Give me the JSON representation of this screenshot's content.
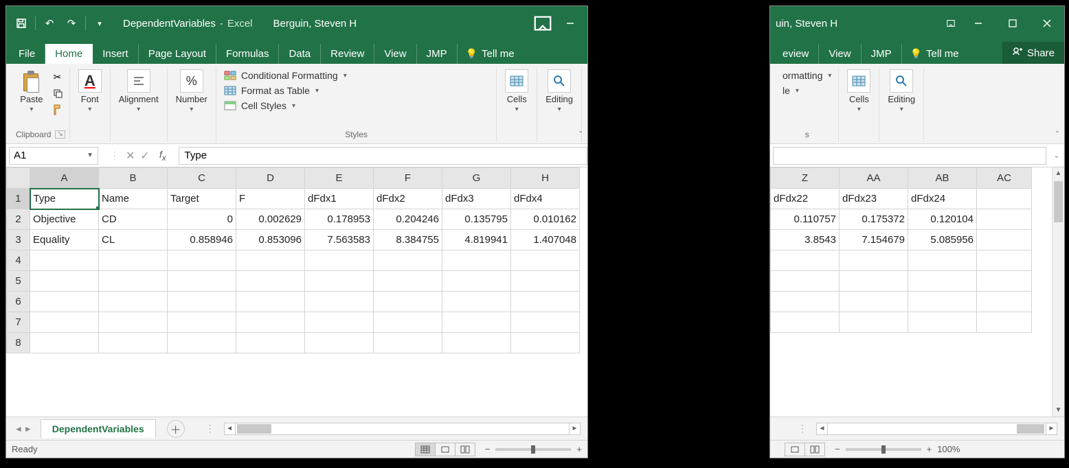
{
  "left": {
    "title": {
      "filename": "DependentVariables",
      "sep": "-",
      "app": "Excel",
      "user": "Berguin, Steven H"
    },
    "tabs": [
      "File",
      "Home",
      "Insert",
      "Page Layout",
      "Formulas",
      "Data",
      "Review",
      "View",
      "JMP"
    ],
    "active_tab": "Home",
    "tell_me": "Tell me",
    "ribbon": {
      "clipboard": {
        "paste": "Paste",
        "label": "Clipboard"
      },
      "font": {
        "btn": "Font",
        "label": ""
      },
      "alignment": {
        "btn": "Alignment"
      },
      "number": {
        "btn": "Number"
      },
      "styles": {
        "cond": "Conditional Formatting",
        "table": "Format as Table",
        "cell": "Cell Styles",
        "label": "Styles"
      },
      "cells": {
        "btn": "Cells"
      },
      "editing": {
        "btn": "Editing"
      }
    },
    "namebox": "A1",
    "formula": "Type",
    "columns": [
      "A",
      "B",
      "C",
      "D",
      "E",
      "F",
      "G",
      "H"
    ],
    "widths": [
      100,
      100,
      100,
      100,
      100,
      100,
      100,
      100
    ],
    "rows": [
      {
        "n": 1,
        "cells": [
          {
            "v": "Type",
            "t": "txt",
            "active": true
          },
          {
            "v": "Name",
            "t": "txt"
          },
          {
            "v": "Target",
            "t": "txt"
          },
          {
            "v": "F",
            "t": "txt"
          },
          {
            "v": "dFdx1",
            "t": "txt"
          },
          {
            "v": "dFdx2",
            "t": "txt"
          },
          {
            "v": "dFdx3",
            "t": "txt"
          },
          {
            "v": "dFdx4",
            "t": "txt"
          }
        ]
      },
      {
        "n": 2,
        "cells": [
          {
            "v": "Objective",
            "t": "txt"
          },
          {
            "v": "CD",
            "t": "txt"
          },
          {
            "v": "0",
            "t": "num"
          },
          {
            "v": "0.002629",
            "t": "num"
          },
          {
            "v": "0.178953",
            "t": "num"
          },
          {
            "v": "0.204246",
            "t": "num"
          },
          {
            "v": "0.135795",
            "t": "num"
          },
          {
            "v": "0.010162",
            "t": "num"
          }
        ]
      },
      {
        "n": 3,
        "cells": [
          {
            "v": "Equality",
            "t": "txt"
          },
          {
            "v": "CL",
            "t": "txt"
          },
          {
            "v": "0.858946",
            "t": "num"
          },
          {
            "v": "0.853096",
            "t": "num"
          },
          {
            "v": "7.563583",
            "t": "num"
          },
          {
            "v": "8.384755",
            "t": "num"
          },
          {
            "v": "4.819941",
            "t": "num"
          },
          {
            "v": "1.407048",
            "t": "num"
          }
        ]
      },
      {
        "n": 4,
        "cells": [
          {
            "v": ""
          },
          {
            "v": ""
          },
          {
            "v": ""
          },
          {
            "v": ""
          },
          {
            "v": ""
          },
          {
            "v": ""
          },
          {
            "v": ""
          },
          {
            "v": ""
          }
        ]
      },
      {
        "n": 5,
        "cells": [
          {
            "v": ""
          },
          {
            "v": ""
          },
          {
            "v": ""
          },
          {
            "v": ""
          },
          {
            "v": ""
          },
          {
            "v": ""
          },
          {
            "v": ""
          },
          {
            "v": ""
          }
        ]
      },
      {
        "n": 6,
        "cells": [
          {
            "v": ""
          },
          {
            "v": ""
          },
          {
            "v": ""
          },
          {
            "v": ""
          },
          {
            "v": ""
          },
          {
            "v": ""
          },
          {
            "v": ""
          },
          {
            "v": ""
          }
        ]
      },
      {
        "n": 7,
        "cells": [
          {
            "v": ""
          },
          {
            "v": ""
          },
          {
            "v": ""
          },
          {
            "v": ""
          },
          {
            "v": ""
          },
          {
            "v": ""
          },
          {
            "v": ""
          },
          {
            "v": ""
          }
        ]
      },
      {
        "n": 8,
        "cells": [
          {
            "v": ""
          },
          {
            "v": ""
          },
          {
            "v": ""
          },
          {
            "v": ""
          },
          {
            "v": ""
          },
          {
            "v": ""
          },
          {
            "v": ""
          },
          {
            "v": ""
          }
        ]
      }
    ],
    "sheet_tab": "DependentVariables",
    "status": "Ready"
  },
  "right": {
    "title": {
      "user_partial": "uin, Steven H"
    },
    "tabs_partial": [
      "eview",
      "View",
      "JMP"
    ],
    "tell_me": "Tell me",
    "share": "Share",
    "ribbon": {
      "styles_partial": {
        "cond": "ormatting",
        "table": "le"
      },
      "styles_label_partial": "s",
      "cells": "Cells",
      "editing": "Editing"
    },
    "columns": [
      "Z",
      "AA",
      "AB",
      "AC"
    ],
    "widths": [
      100,
      100,
      100,
      80
    ],
    "rows": [
      {
        "n": 1,
        "cells": [
          {
            "v": "dFdx22",
            "t": "txt"
          },
          {
            "v": "dFdx23",
            "t": "txt"
          },
          {
            "v": "dFdx24",
            "t": "txt"
          },
          {
            "v": "",
            "t": "txt"
          }
        ]
      },
      {
        "n": 2,
        "cells": [
          {
            "v": "0.110757",
            "t": "num"
          },
          {
            "v": "0.175372",
            "t": "num"
          },
          {
            "v": "0.120104",
            "t": "num"
          },
          {
            "v": "",
            "t": "txt"
          }
        ]
      },
      {
        "n": 3,
        "cells": [
          {
            "v": "3.8543",
            "t": "num"
          },
          {
            "v": "7.154679",
            "t": "num"
          },
          {
            "v": "5.085956",
            "t": "num"
          },
          {
            "v": "",
            "t": "txt"
          }
        ]
      },
      {
        "n": 4,
        "cells": [
          {
            "v": ""
          },
          {
            "v": ""
          },
          {
            "v": ""
          },
          {
            "v": ""
          }
        ]
      },
      {
        "n": 5,
        "cells": [
          {
            "v": ""
          },
          {
            "v": ""
          },
          {
            "v": ""
          },
          {
            "v": ""
          }
        ]
      },
      {
        "n": 6,
        "cells": [
          {
            "v": ""
          },
          {
            "v": ""
          },
          {
            "v": ""
          },
          {
            "v": ""
          }
        ]
      },
      {
        "n": 7,
        "cells": [
          {
            "v": ""
          },
          {
            "v": ""
          },
          {
            "v": ""
          },
          {
            "v": ""
          }
        ]
      }
    ],
    "zoom": "100%"
  }
}
